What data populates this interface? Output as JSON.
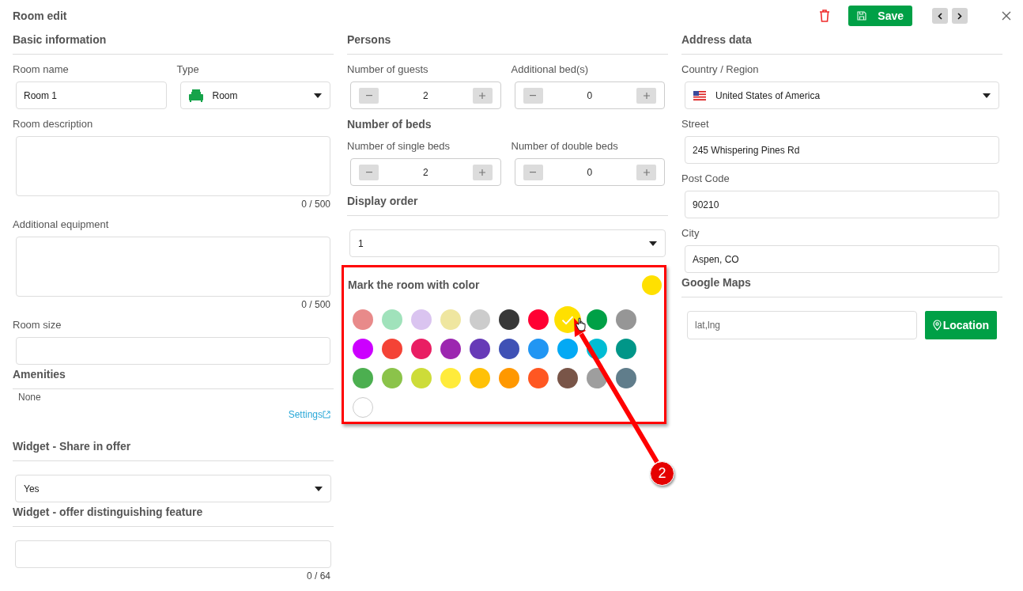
{
  "header": {
    "title": "Room edit",
    "save_label": "Save"
  },
  "columns": [
    {
      "items": [
        {
          "kind": "heading",
          "text": "Basic information"
        },
        {
          "kind": "pair",
          "fields": [
            {
              "kind": "input",
              "label": "Room name",
              "value": "Room 1"
            },
            {
              "kind": "type_select",
              "label": "Type",
              "value": "Room"
            }
          ]
        },
        {
          "kind": "textarea",
          "label": "Room description",
          "counter": "0 / 500"
        },
        {
          "kind": "textarea",
          "label": "Additional equipment",
          "counter": "0 / 500"
        },
        {
          "kind": "input",
          "label": "Room size"
        },
        {
          "kind": "heading",
          "text": "Amenities"
        },
        {
          "kind": "note",
          "text": "None"
        },
        {
          "kind": "link",
          "text": "Settings"
        },
        {
          "kind": "heading",
          "text": "Widget - Share in offer"
        },
        {
          "kind": "select",
          "value": "Yes"
        },
        {
          "kind": "heading",
          "text": "Widget - offer distinguishing feature"
        },
        {
          "kind": "input",
          "counter": "0 / 64"
        }
      ]
    },
    {
      "items": [
        {
          "kind": "heading",
          "text": "Persons"
        },
        {
          "kind": "pair",
          "fields": [
            {
              "kind": "stepper",
              "label": "Number of guests",
              "value": "2"
            },
            {
              "kind": "stepper",
              "label": "Additional bed(s)",
              "value": "0"
            }
          ]
        },
        {
          "kind": "subheading",
          "text": "Number of beds"
        },
        {
          "kind": "pair",
          "fields": [
            {
              "kind": "stepper",
              "label": "Number of single beds",
              "value": "2"
            },
            {
              "kind": "stepper",
              "label": "Number of double beds",
              "value": "0"
            }
          ]
        },
        {
          "kind": "heading",
          "text": "Display order"
        },
        {
          "kind": "select",
          "value": "1"
        },
        {
          "kind": "colors",
          "title": "Mark the room with color",
          "swatches": [
            {
              "color": "#e88a8a",
              "selected": false
            },
            {
              "color": "#a0e2bb",
              "selected": false
            },
            {
              "color": "#dac4f0",
              "selected": false
            },
            {
              "color": "#efe6a0",
              "selected": false
            },
            {
              "color": "#cccccc",
              "selected": false
            },
            {
              "color": "#383838",
              "selected": false
            },
            {
              "color": "#ff0033",
              "selected": false
            },
            {
              "color": "#ffe000",
              "selected": true
            },
            {
              "color": "#00a046",
              "selected": false
            },
            {
              "color": "#969696",
              "selected": false
            },
            {
              "color": "#cc00ff",
              "selected": false
            },
            {
              "color": "#f44336",
              "selected": false
            },
            {
              "color": "#e91e63",
              "selected": false
            },
            {
              "color": "#9c27b0",
              "selected": false
            },
            {
              "color": "#673ab7",
              "selected": false
            },
            {
              "color": "#3f51b5",
              "selected": false
            },
            {
              "color": "#2196f3",
              "selected": false
            },
            {
              "color": "#03a9f4",
              "selected": false
            },
            {
              "color": "#00bcd4",
              "selected": false
            },
            {
              "color": "#009688",
              "selected": false
            },
            {
              "color": "#4caf50",
              "selected": false
            },
            {
              "color": "#8bc34a",
              "selected": false
            },
            {
              "color": "#cddc39",
              "selected": false
            },
            {
              "color": "#ffeb3b",
              "selected": false
            },
            {
              "color": "#ffc107",
              "selected": false
            },
            {
              "color": "#ff9800",
              "selected": false
            },
            {
              "color": "#ff5722",
              "selected": false
            },
            {
              "color": "#795548",
              "selected": false
            },
            {
              "color": "#9e9e9e",
              "selected": false
            },
            {
              "color": "#607d8b",
              "selected": false
            },
            {
              "color": "#ffffff",
              "selected": false
            }
          ]
        }
      ]
    },
    {
      "items": [
        {
          "kind": "heading",
          "text": "Address data"
        },
        {
          "kind": "country_select",
          "label": "Country / Region",
          "value": "United States of America"
        },
        {
          "kind": "input",
          "label": "Street",
          "value": "245 Whispering Pines Rd"
        },
        {
          "kind": "input",
          "label": "Post Code",
          "value": "90210"
        },
        {
          "kind": "input",
          "label": "City",
          "value": "Aspen, CO"
        },
        {
          "kind": "heading",
          "text": "Google Maps"
        },
        {
          "kind": "location",
          "placeholder": "lat,lng",
          "button": "Location"
        }
      ]
    }
  ],
  "annotation": {
    "badge": "2"
  }
}
